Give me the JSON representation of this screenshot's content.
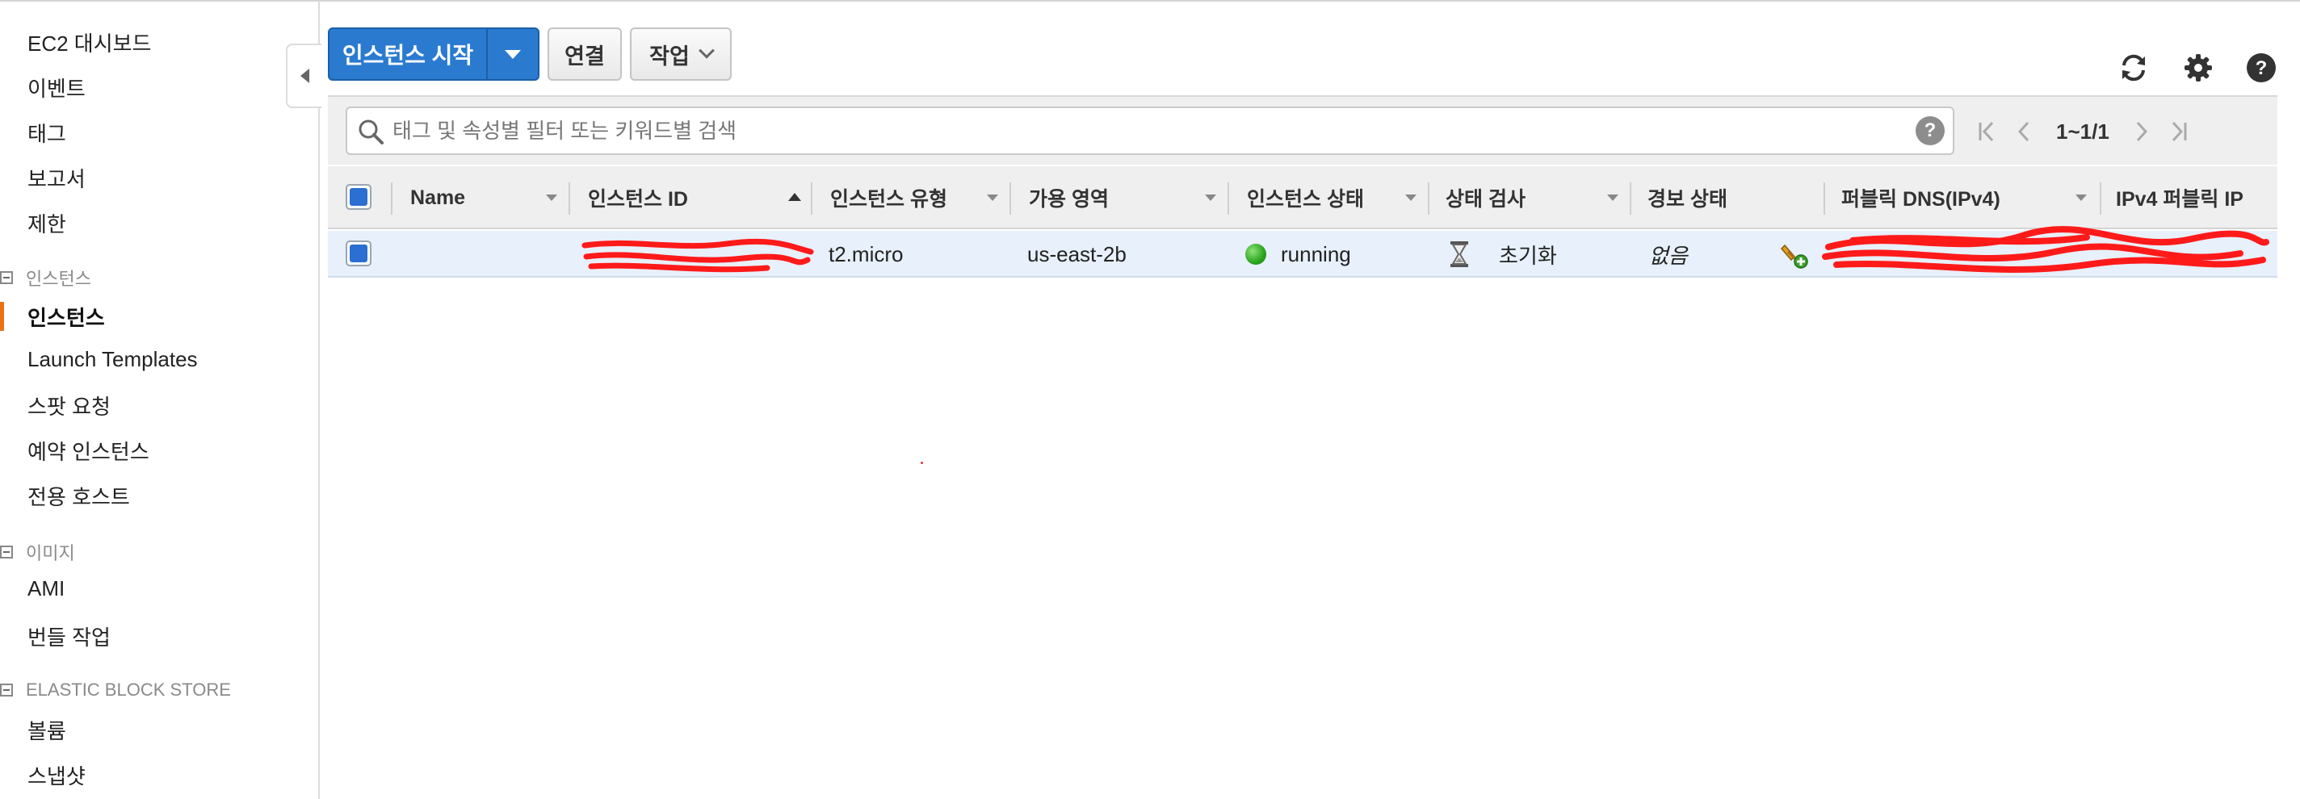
{
  "sidebar": {
    "items": [
      {
        "label": "EC2 대시보드"
      },
      {
        "label": "이벤트"
      },
      {
        "label": "태그"
      },
      {
        "label": "보고서"
      },
      {
        "label": "제한"
      }
    ],
    "sections": [
      {
        "title": "인스턴스",
        "items": [
          {
            "label": "인스턴스",
            "active": true
          },
          {
            "label": "Launch Templates"
          },
          {
            "label": "스팟 요청"
          },
          {
            "label": "예약 인스턴스"
          },
          {
            "label": "전용 호스트"
          }
        ]
      },
      {
        "title": "이미지",
        "items": [
          {
            "label": "AMI"
          },
          {
            "label": "번들 작업"
          }
        ]
      },
      {
        "title": "ELASTIC BLOCK STORE",
        "items": [
          {
            "label": "볼륨"
          },
          {
            "label": "스냅샷"
          }
        ]
      }
    ]
  },
  "toolbar": {
    "launch_label": "인스턴스 시작",
    "connect_label": "연결",
    "actions_label": "작업"
  },
  "top_icons": [
    "refresh-icon",
    "gear-icon",
    "help-icon"
  ],
  "search": {
    "placeholder": "태그 및 속성별 필터 또는 키워드별 검색",
    "value": "",
    "help_glyph": "?"
  },
  "pagination": {
    "count": "1~1/1"
  },
  "table": {
    "columns": [
      {
        "label": "Name"
      },
      {
        "label": "인스턴스 ID"
      },
      {
        "label": "인스턴스 유형"
      },
      {
        "label": "가용 영역"
      },
      {
        "label": "인스턴스 상태"
      },
      {
        "label": "상태 검사"
      },
      {
        "label": "경보 상태"
      },
      {
        "label": "퍼블릭 DNS(IPv4)"
      },
      {
        "label": "IPv4 퍼블릭 IP"
      }
    ],
    "rows": [
      {
        "selected": true,
        "name": "",
        "instance_type": "t2.micro",
        "availability_zone": "us-east-2b",
        "instance_state": "running",
        "status_check": "초기화",
        "alarm_status": "없음"
      }
    ]
  },
  "colors": {
    "primary_button": "#2a7bd0",
    "active_nav_marker": "#ec7211",
    "running_status": "#29a51c",
    "selected_row": "#e7f0fb",
    "redaction": "#ff1a1a"
  }
}
